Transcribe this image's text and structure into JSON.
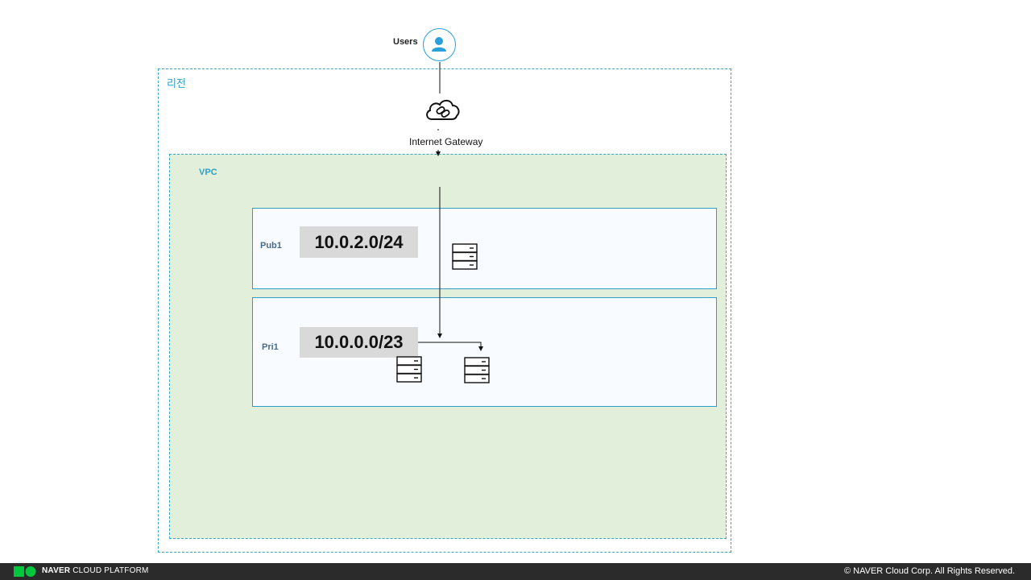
{
  "users": {
    "label": "Users",
    "icon": "user-icon"
  },
  "region": {
    "label": "리전"
  },
  "internet_gateway": {
    "label": "Internet Gateway",
    "icon": "cloud-link-icon"
  },
  "vpc": {
    "label": "VPC"
  },
  "subnets": [
    {
      "name": "Pub1",
      "cidr": "10.0.2.0/24",
      "servers": 1
    },
    {
      "name": "Pri1",
      "cidr": "10.0.0.0/23",
      "servers": 2
    }
  ],
  "footer": {
    "brand_bold": "NAVER",
    "brand_rest": "CLOUD PLATFORM",
    "copyright": "© NAVER Cloud Corp. All Rights Reserved."
  },
  "colors": {
    "accent": "#2e9fc4",
    "vpc_fill": "#e2efda",
    "cidr_fill": "#d9d9d9",
    "footer_bg": "#2b2b2b",
    "logo_green": "#00c73c"
  }
}
